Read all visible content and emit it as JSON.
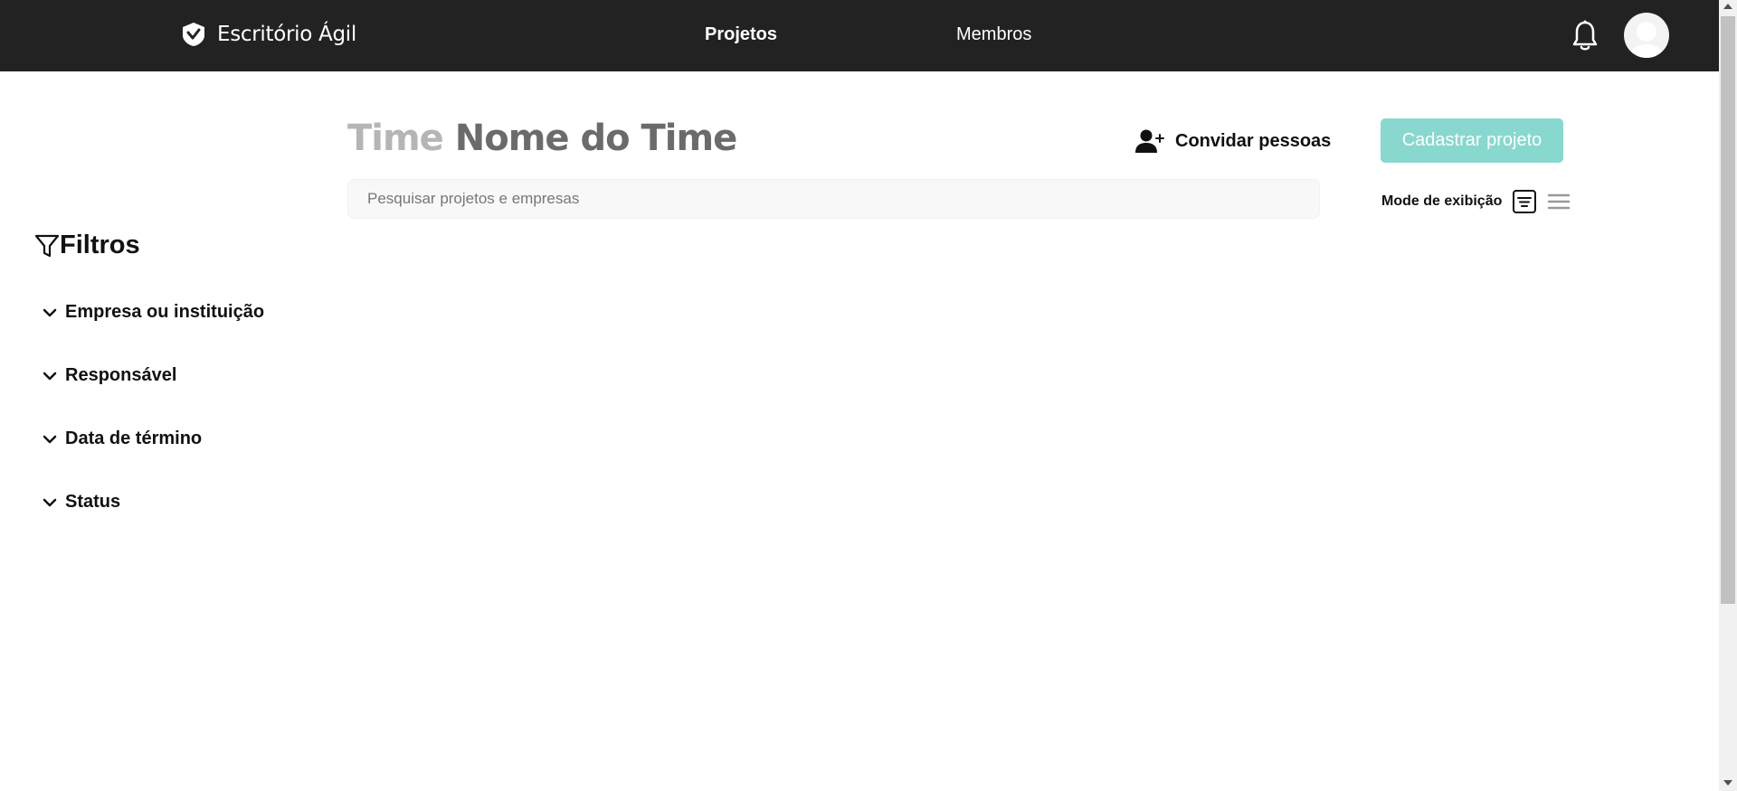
{
  "header": {
    "brand": "Escritório Ágil",
    "nav": {
      "projects": "Projetos",
      "members": "Membros"
    },
    "icons": {
      "logo": "shield-check-icon",
      "bell": "bell-icon",
      "avatar": "user-avatar-icon"
    }
  },
  "team": {
    "label": "Time",
    "name": "Nome do Time"
  },
  "actions": {
    "invite_label": "Convidar pessoas",
    "create_project_label": "Cadastrar projeto"
  },
  "search": {
    "placeholder": "Pesquisar projetos e empresas",
    "value": ""
  },
  "view_mode": {
    "label": "Mode de exibição",
    "options": [
      "cards-icon",
      "list-icon"
    ]
  },
  "filters": {
    "title": "Filtros",
    "items": [
      "Empresa ou instituição",
      "Responsável",
      "Data de término",
      "Status"
    ]
  },
  "colors": {
    "topbar": "#222222",
    "accent": "#88d8cf",
    "team_label": "#b5b5b5",
    "team_name": "#6b6b6b"
  }
}
